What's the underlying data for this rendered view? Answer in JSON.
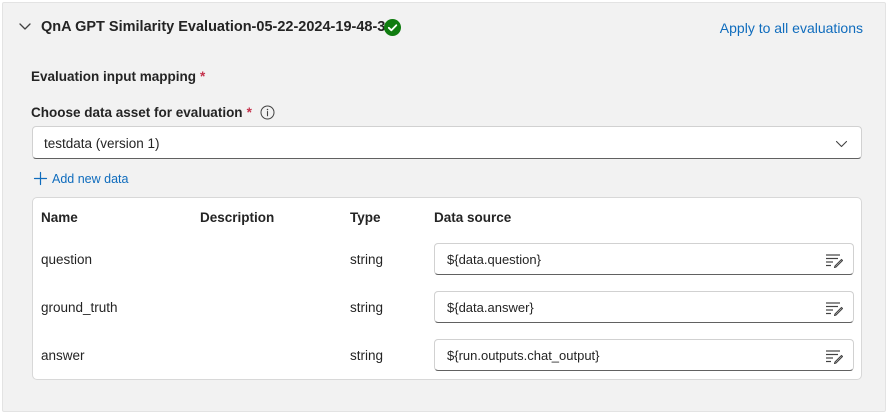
{
  "header": {
    "title": "QnA GPT Similarity Evaluation-05-22-2024-19-48-33",
    "status_icon": "success-check-icon",
    "apply_link": "Apply to all evaluations"
  },
  "mapping": {
    "section_label": "Evaluation input mapping",
    "required_mark": "*",
    "choose_label": "Choose data asset for evaluation",
    "selected_asset": "testdata (version 1)",
    "add_new_data": "Add new data"
  },
  "table": {
    "columns": [
      "Name",
      "Description",
      "Type",
      "Data source"
    ],
    "rows": [
      {
        "name": "question",
        "description": "",
        "type": "string",
        "data_source": "${data.question}"
      },
      {
        "name": "ground_truth",
        "description": "",
        "type": "string",
        "data_source": "${data.answer}"
      },
      {
        "name": "answer",
        "description": "",
        "type": "string",
        "data_source": "${run.outputs.chat_output}"
      }
    ]
  },
  "colors": {
    "accent": "#0f6cbd",
    "success": "#107c10",
    "required": "#c4314b",
    "panel_bg": "#f2f2f2"
  }
}
